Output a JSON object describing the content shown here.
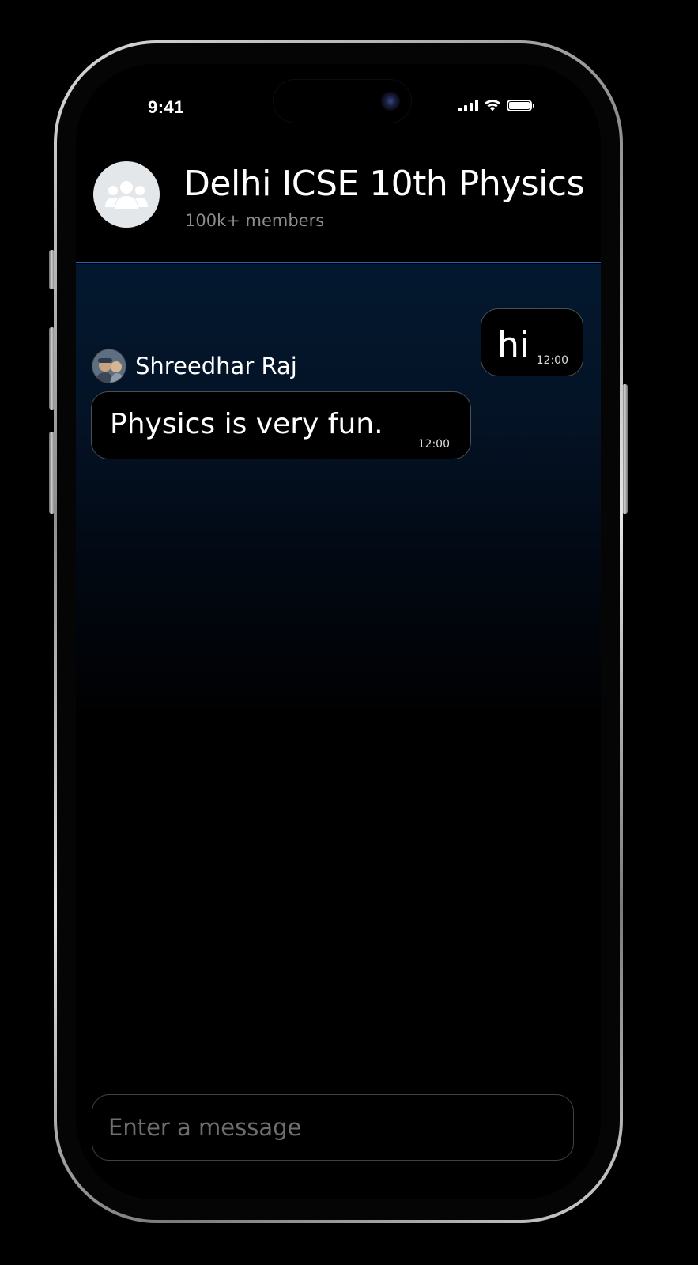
{
  "status_bar": {
    "time": "9:41"
  },
  "chat_header": {
    "title": "Delhi ICSE 10th Physics",
    "members": "100k+ members",
    "accent_color": "#1e5fbf"
  },
  "messages": [
    {
      "direction": "outgoing",
      "text": "hi",
      "time": "12:00"
    },
    {
      "direction": "incoming",
      "sender": "Shreedhar Raj",
      "text": "Physics is very fun.",
      "time": "12:00"
    }
  ],
  "composer": {
    "placeholder": "Enter a message"
  },
  "icons": {
    "group_avatar": "group-icon",
    "signal": "cellular-signal-icon",
    "wifi": "wifi-icon",
    "battery": "battery-icon"
  }
}
